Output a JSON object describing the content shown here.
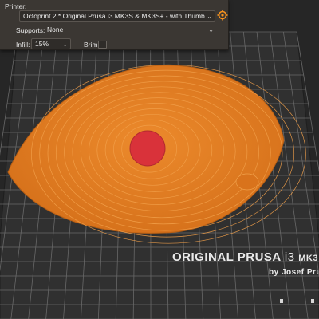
{
  "printer": {
    "label": "Printer:",
    "value": "Octoprint 2 * Original Prusa i3 MK3S & MK3S+ - with Thumb..."
  },
  "supports": {
    "label": "Supports:",
    "value": "None"
  },
  "infill": {
    "label": "Infill:",
    "value": "15%"
  },
  "brim": {
    "label": "Brim:"
  },
  "bed": {
    "title_main": "ORIGINAL PRUSA",
    "title_model": "i3",
    "title_version": "MK3",
    "subtitle": "by Josef Pru"
  },
  "colors": {
    "accent": "#f7931e",
    "model": "#e57e22",
    "model_center": "#d9323a",
    "bed": "#2f2f2f",
    "grid": "#6a6a6a",
    "panel": "#3b3733"
  },
  "icons": {
    "printer_settings": "gear-icon",
    "dropdown": "chevron-down-icon"
  }
}
